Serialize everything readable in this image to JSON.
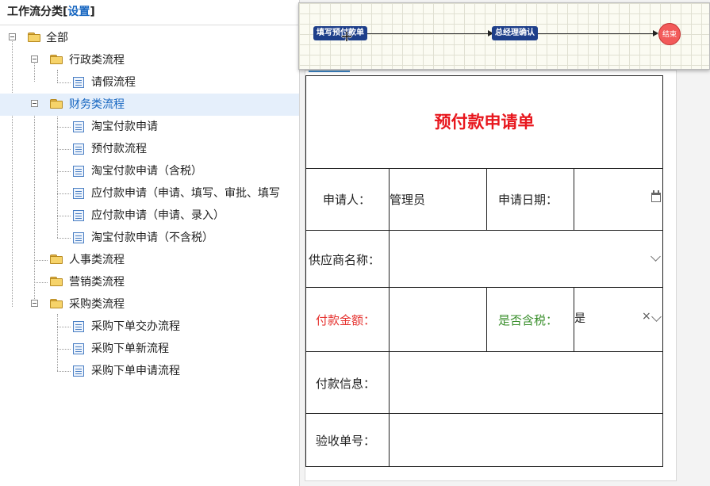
{
  "left_panel": {
    "header": {
      "title": "工作流分类",
      "open": "[",
      "link": "设置",
      "close": "]"
    },
    "tree": [
      {
        "label": "全部",
        "kind": "folder",
        "expanded": true
      },
      {
        "label": "行政类流程",
        "kind": "folder",
        "expanded": true
      },
      {
        "label": "请假流程",
        "kind": "doc"
      },
      {
        "label": "财务类流程",
        "kind": "folder",
        "expanded": true,
        "selected": true
      },
      {
        "label": "淘宝付款申请",
        "kind": "doc"
      },
      {
        "label": "预付款流程",
        "kind": "doc"
      },
      {
        "label": "淘宝付款申请（含税）",
        "kind": "doc"
      },
      {
        "label": "应付款申请（申请、填写、审批、填写",
        "kind": "doc"
      },
      {
        "label": "应付款申请（申请、录入）",
        "kind": "doc"
      },
      {
        "label": "淘宝付款申请（不含税）",
        "kind": "doc"
      },
      {
        "label": "人事类流程",
        "kind": "folder"
      },
      {
        "label": "营销类流程",
        "kind": "folder"
      },
      {
        "label": "采购类流程",
        "kind": "folder",
        "expanded": true
      },
      {
        "label": "采购下单交办流程",
        "kind": "doc"
      },
      {
        "label": "采购下单新流程",
        "kind": "doc"
      },
      {
        "label": "采购下单申请流程",
        "kind": "doc"
      }
    ]
  },
  "flow_diagram": {
    "nodes": [
      {
        "label": "填写预付款单"
      },
      {
        "label": "总经理确认"
      },
      {
        "label": "结束"
      }
    ]
  },
  "form": {
    "title": "预付款申请单",
    "applicant_label": "申请人：",
    "applicant_value": "管理员",
    "date_label": "申请日期：",
    "date_value": "",
    "supplier_label": "供应商名称：",
    "supplier_value": "",
    "amount_label": "付款金额：",
    "amount_value": "",
    "tax_label": "是否含税：",
    "tax_value": "是",
    "clear_symbol": "×",
    "payment_info_label": "付款信息：",
    "payment_info_value": "",
    "receipt_label": "验收单号：",
    "receipt_value": ""
  },
  "colors": {
    "title": "#e8161d",
    "amount_label": "#e5312e",
    "tax_label": "#3a8f2c",
    "link": "#1565c0",
    "selected_row": "#e5effb",
    "flow_node": "#1e3f8a",
    "flow_end": "#f25a5a"
  },
  "icons": [
    "collapse-toggle-icon",
    "folder-icon",
    "document-icon",
    "calendar-icon",
    "chevron-down-icon",
    "clear-icon",
    "move-cursor-icon"
  ]
}
